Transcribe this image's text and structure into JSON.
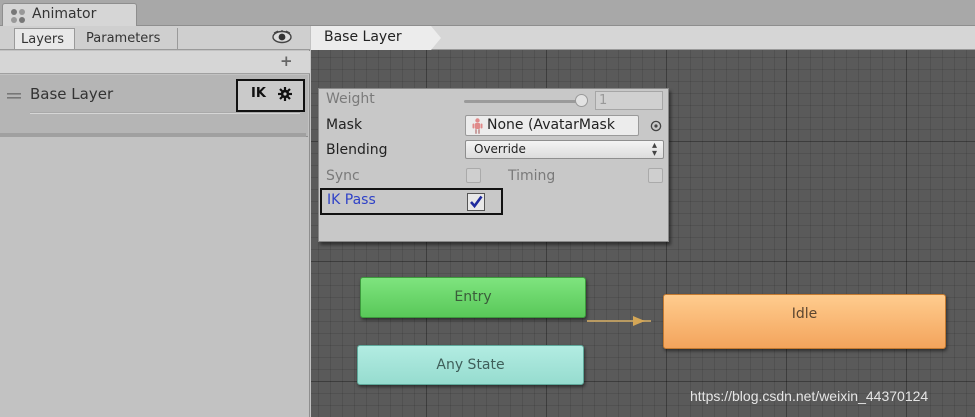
{
  "window": {
    "tab_title": "Animator"
  },
  "left_panel": {
    "tabs": [
      {
        "label": "Layers"
      },
      {
        "label": "Parameters"
      }
    ],
    "add_label": "+",
    "layers": [
      {
        "name": "Base Layer",
        "badge": "IK"
      }
    ]
  },
  "graph": {
    "breadcrumb": "Base Layer",
    "states": {
      "entry": "Entry",
      "any_state": "Any State",
      "idle": "Idle"
    }
  },
  "layer_settings": {
    "weight_label": "Weight",
    "weight_value": "1",
    "weight_fraction": 1.0,
    "mask_label": "Mask",
    "mask_value": "None (AvatarMask",
    "blending_label": "Blending",
    "blending_value": "Override",
    "sync_label": "Sync",
    "timing_label": "Timing",
    "ik_pass_label": "IK Pass",
    "ik_pass_checked": true
  },
  "watermark": "https://blog.csdn.net/weixin_44370124",
  "colors": {
    "entry": "#6fd86f",
    "any_state": "#a4e4d8",
    "idle": "#f9b574",
    "ik_label": "#2f42c7",
    "graph_bg": "#5a5a5a"
  },
  "icons": [
    "animator-icon",
    "eye-icon",
    "drag-handle-icon",
    "gear-icon",
    "avatar-mask-icon",
    "object-picker-icon",
    "checkmark-icon",
    "transition-arrow-icon"
  ]
}
